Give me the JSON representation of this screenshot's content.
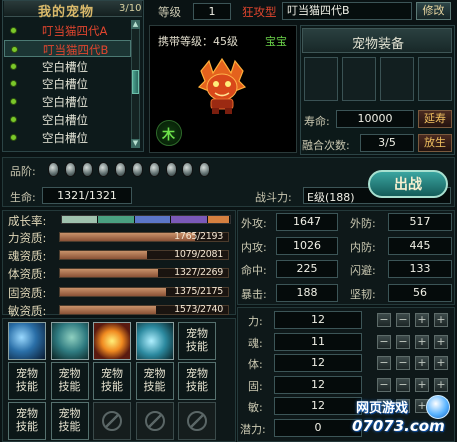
{
  "left_panel": {
    "title": "我的宠物",
    "count": "3/10",
    "pets": [
      {
        "name": "叮当猫四代A",
        "color": "#e0452e"
      },
      {
        "name": "叮当猫四代B",
        "color": "#e0452e"
      },
      {
        "name": "空白槽位",
        "color": "#e6e6d8"
      },
      {
        "name": "空白槽位",
        "color": "#e6e6d8"
      },
      {
        "name": "空白槽位",
        "color": "#e6e6d8"
      },
      {
        "name": "空白槽位",
        "color": "#e6e6d8"
      },
      {
        "name": "空白槽位",
        "color": "#e6e6d8"
      }
    ]
  },
  "header": {
    "level_label": "等级",
    "level_value": "1",
    "type_label": "狂攻型",
    "pet_name": "叮当猫四代B",
    "rename_button": "修改"
  },
  "portrait": {
    "carry_level": "携带等级：45级",
    "baby_tag": "宝宝",
    "element": "木"
  },
  "equipment": {
    "title": "宠物装备",
    "lifespan_label": "寿命:",
    "lifespan_value": "10000",
    "extend_button": "延寿",
    "fusion_label": "融合次数:",
    "fusion_value": "3/5",
    "release_button": "放生"
  },
  "summary": {
    "quality_label": "品阶:",
    "gem_count": 10,
    "hp_label": "生命:",
    "hp_value": "1321/1321",
    "power_label": "战斗力:",
    "power_value": "E级(188)",
    "battle_button": "出战"
  },
  "aptitudes": {
    "growth_label": "成长率:",
    "growth_segments": [
      "#9fc2ae",
      "#4aa080",
      "#5b76c8",
      "#7a59b8",
      "#d58040"
    ],
    "items": [
      {
        "label": "力资质:",
        "value": "1765/2193",
        "ratio": 0.805
      },
      {
        "label": "魂资质:",
        "value": "1079/2081",
        "ratio": 0.518
      },
      {
        "label": "体资质:",
        "value": "1327/2269",
        "ratio": 0.585
      },
      {
        "label": "固资质:",
        "value": "1375/2175",
        "ratio": 0.632
      },
      {
        "label": "敏资质:",
        "value": "1573/2740",
        "ratio": 0.574
      }
    ]
  },
  "combat_stats": [
    {
      "label": "外攻:",
      "value": "1647",
      "label2": "外防:",
      "value2": "517"
    },
    {
      "label": "内攻:",
      "value": "1026",
      "label2": "内防:",
      "value2": "445"
    },
    {
      "label": "命中:",
      "value": "225",
      "label2": "闪避:",
      "value2": "133"
    },
    {
      "label": "暴击:",
      "value": "188",
      "label2": "坚韧:",
      "value2": "56"
    }
  ],
  "attributes": [
    {
      "label": "力:",
      "value": "12"
    },
    {
      "label": "魂:",
      "value": "11"
    },
    {
      "label": "体:",
      "value": "12"
    },
    {
      "label": "固:",
      "value": "12"
    },
    {
      "label": "敏:",
      "value": "12"
    },
    {
      "label": "潜力:",
      "value": "0"
    }
  ],
  "skills": {
    "slot_text": "宠物技能",
    "icon_slots": [
      "skill-icon-moon",
      "skill-icon-beast",
      "skill-icon-sun",
      "skill-icon-dragon"
    ]
  },
  "watermark": {
    "line1": "网页游戏",
    "line2": "07073.com"
  }
}
